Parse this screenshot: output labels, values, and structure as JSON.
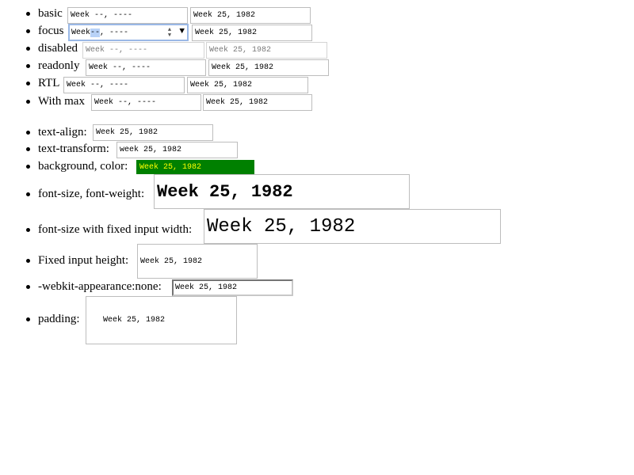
{
  "rows": [
    {
      "label": "basic",
      "empty_value": "Week --, ----",
      "filled_value": "Week 25, 1982"
    },
    {
      "label": "focus",
      "empty_prefix": "Week ",
      "empty_segment": "--",
      "empty_suffix": ", ----",
      "filled_value": "Week 25, 1982",
      "spin_icon": "spinner-arrows-icon",
      "dropdown_icon": "dropdown-triangle-icon"
    },
    {
      "label": "disabled",
      "empty_value": "Week --, ----",
      "filled_value": "Week 25, 1982"
    },
    {
      "label": "readonly",
      "empty_value": "Week --, ----",
      "filled_value": "Week 25, 1982"
    },
    {
      "label": "RTL",
      "empty_value": "Week --, ----",
      "filled_value": "Week 25, 1982"
    },
    {
      "label": "With max",
      "empty_value": "Week --, ----",
      "filled_value": "Week 25, 1982"
    }
  ],
  "styled_rows": [
    {
      "label": "text-align:",
      "value": "Week 25, 1982"
    },
    {
      "label": "text-transform:",
      "value": "week 25, 1982"
    },
    {
      "label": "background, color:",
      "value": "Week 25, 1982",
      "background": "#008000",
      "color": "#ffff00"
    },
    {
      "label": "font-size, font-weight:",
      "value": "Week 25, 1982"
    },
    {
      "label": "font-size with fixed input width:",
      "value": "Week 25, 1982"
    },
    {
      "label": "Fixed input height:",
      "value": "Week 25, 1982"
    },
    {
      "label": "-webkit-appearance:none:",
      "value": "Week 25, 1982"
    },
    {
      "label": "padding:",
      "value": "Week 25, 1982"
    }
  ]
}
